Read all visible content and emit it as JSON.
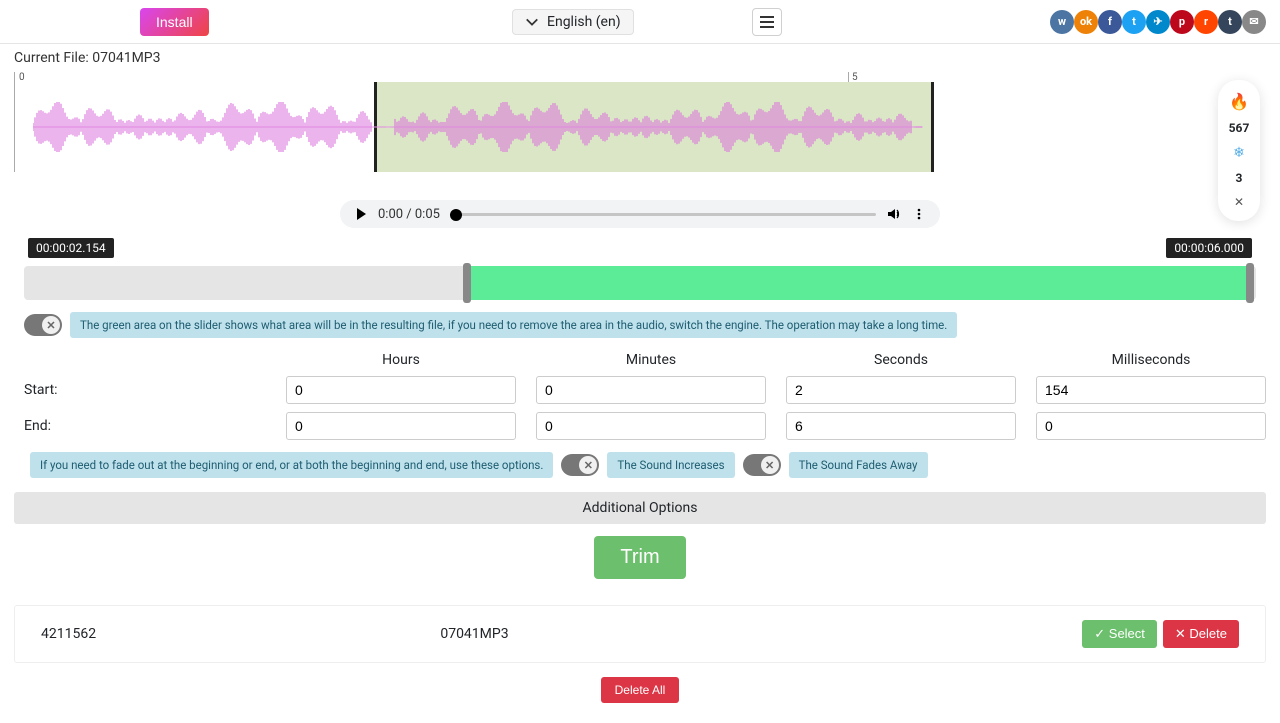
{
  "header": {
    "install": "Install",
    "language": "English (en)"
  },
  "currentFile": "Current File: 07041MP3",
  "player": {
    "time": "0:00 / 0:05"
  },
  "timecodes": {
    "start": "00:00:02.154",
    "end": "00:00:06.000"
  },
  "hint1": "The green area on the slider shows what area will be in the resulting file, if you need to remove the area in the audio, switch the engine. The operation may take a long time.",
  "cols": {
    "h": "Hours",
    "m": "Minutes",
    "s": "Seconds",
    "ms": "Milliseconds"
  },
  "labels": {
    "start": "Start:",
    "end": "End:"
  },
  "start": {
    "h": "0",
    "m": "0",
    "s": "2",
    "ms": "154"
  },
  "end": {
    "h": "0",
    "m": "0",
    "s": "6",
    "ms": "0"
  },
  "hint2": "If you need to fade out at the beginning or end, or at both the beginning and end, use these options.",
  "fades": {
    "inc": "The Sound Increases",
    "fade": "The Sound Fades Away"
  },
  "additional": "Additional Options",
  "trim": "Trim",
  "file": {
    "id": "4211562",
    "name": "07041MP3",
    "select": "✓ Select",
    "del": "✕ Delete"
  },
  "deleteAll": "Delete All",
  "votes": {
    "up": "567",
    "down": "3"
  },
  "ticks": {
    "t0": "0",
    "t5": "5"
  }
}
